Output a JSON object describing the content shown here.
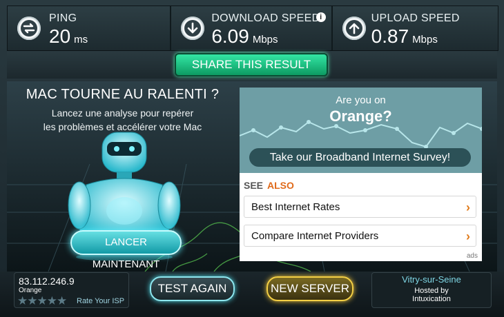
{
  "stats": {
    "ping": {
      "label": "PING",
      "value": "20",
      "unit": "ms"
    },
    "download": {
      "label": "DOWNLOAD SPEED",
      "value": "6.09",
      "unit": "Mbps",
      "info": "i"
    },
    "upload": {
      "label": "UPLOAD SPEED",
      "value": "0.87",
      "unit": "Mbps"
    }
  },
  "share_label": "SHARE THIS RESULT",
  "ad_left": {
    "title": "MAC TOURNE AU RALENTI ?",
    "line1": "Lancez une analyse pour repérer",
    "line2": "les problèmes et accélérer votre Mac",
    "button": "LANCER MAINTENANT"
  },
  "ad_right": {
    "question": "Are you on",
    "isp": "Orange?",
    "survey": "Take our Broadband Internet Survey!",
    "see": "SEE",
    "also": "ALSO",
    "links": [
      "Best Internet Rates",
      "Compare Internet Providers"
    ],
    "chevron": "›",
    "ads": "ads"
  },
  "bottom": {
    "ip": "83.112.246.9",
    "isp": "Orange",
    "stars": "★★★★★",
    "rate": "Rate Your ISP",
    "test_again": "TEST AGAIN",
    "new_server": "NEW SERVER",
    "city": "Vitry-sur-Seine",
    "hosted_by": "Hosted by",
    "host": "Intuxication"
  },
  "colors": {
    "accent_green": "#1fc586",
    "orange": "#e06a1a",
    "cyan": "#8ee7ef",
    "gold": "#f3cf45"
  }
}
